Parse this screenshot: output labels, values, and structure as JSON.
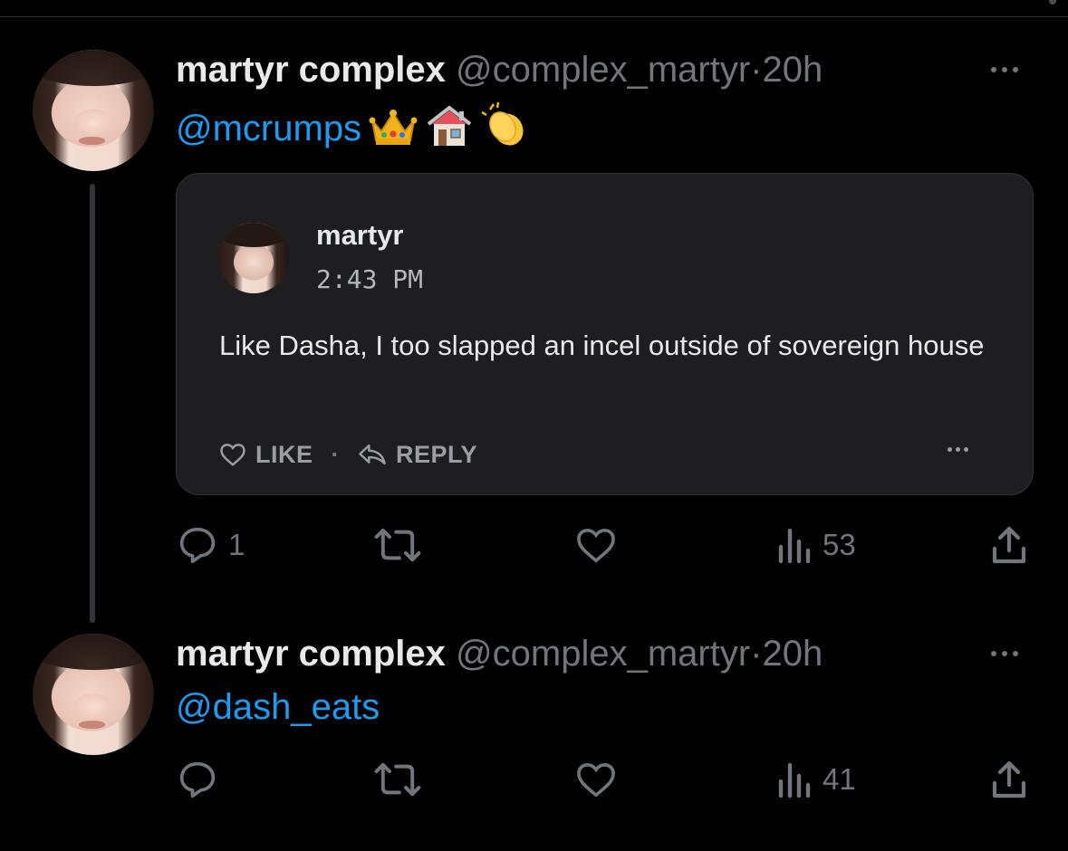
{
  "tweets": [
    {
      "name": "martyr complex",
      "handle": "@complex_martyr",
      "separator": "·",
      "time": "20h",
      "mention": "@mcrumps",
      "emojis": [
        "crown",
        "house",
        "clapping-hands"
      ],
      "quote": {
        "name": "martyr",
        "time": "2:43 PM",
        "body": "Like Dasha, I too slapped an incel outside of sovereign house",
        "like_label": "LIKE",
        "separator": "·",
        "reply_label": "REPLY"
      },
      "stats": {
        "replies": "1",
        "retweets": "",
        "likes": "",
        "views": "53"
      }
    },
    {
      "name": "martyr complex",
      "handle": "@complex_martyr",
      "separator": "·",
      "time": "20h",
      "mention": "@dash_eats",
      "stats": {
        "replies": "",
        "retweets": "",
        "likes": "",
        "views": "41"
      }
    }
  ],
  "colors": {
    "link": "#1d9bf0",
    "muted": "#71767b",
    "text": "#e7e9ea",
    "background": "#000000",
    "card": "#1e1e20"
  },
  "icons": [
    "reply-icon",
    "retweet-icon",
    "like-icon",
    "views-icon",
    "share-icon",
    "more-icon"
  ]
}
